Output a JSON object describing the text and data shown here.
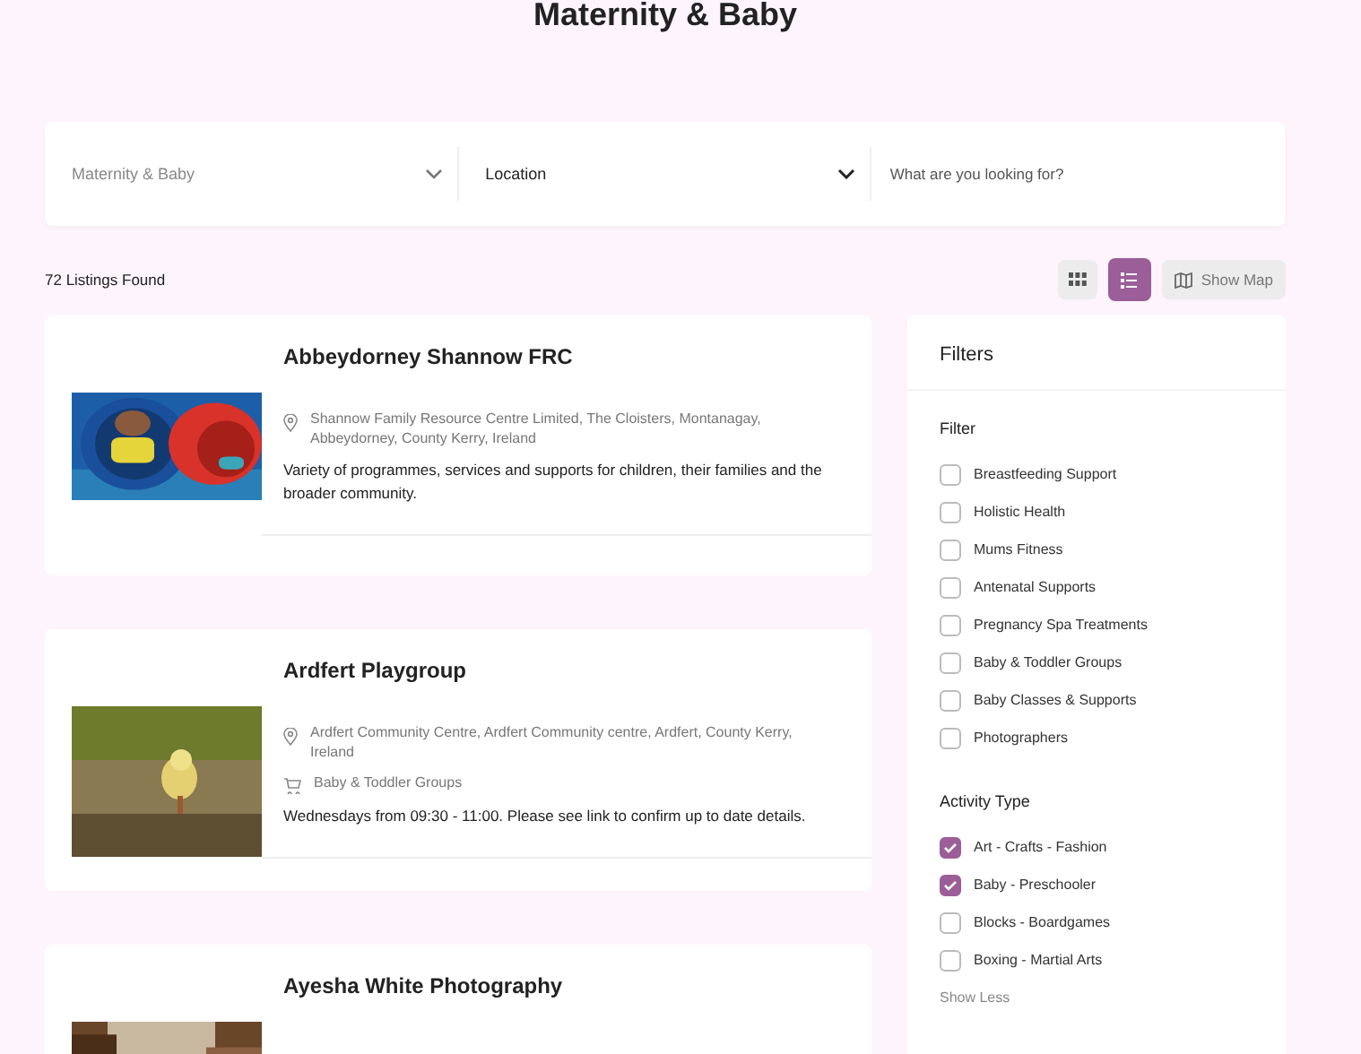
{
  "page_title": "Maternity & Baby",
  "search": {
    "category": "Maternity & Baby",
    "location": "Location",
    "placeholder": "What are you looking for?"
  },
  "results_count": "72 Listings Found",
  "view_toggles": [
    {
      "kind": "grid",
      "selected": false
    },
    {
      "kind": "list",
      "selected": true
    }
  ],
  "map_button": "Show Map",
  "listings": [
    {
      "title": "Abbeydorney Shannow FRC",
      "address": "Shannow Family Resource Centre Limited, The Cloisters, Montanagay, Abbeydorney, County Kerry, Ireland",
      "description": "Variety of programmes, services and supports for children, their families and the broader community."
    },
    {
      "title": "Ardfert Playgroup",
      "address": "Ardfert Community Centre, Ardfert Community centre, Ardfert, County Kerry, Ireland",
      "category": "Baby & Toddler Groups",
      "description": "Wednesdays from 09:30 - 11:00. Please see link to confirm up to date details."
    },
    {
      "title": "Ayesha White Photography"
    }
  ],
  "filters": {
    "title": "Filters",
    "groups": [
      {
        "heading": "Filter",
        "options": [
          {
            "label": "Breastfeeding Support",
            "checked": false
          },
          {
            "label": "Holistic Health",
            "checked": false
          },
          {
            "label": "Mums Fitness",
            "checked": false
          },
          {
            "label": "Antenatal Supports",
            "checked": false
          },
          {
            "label": "Pregnancy Spa Treatments",
            "checked": false
          },
          {
            "label": "Baby & Toddler Groups",
            "checked": false
          },
          {
            "label": "Baby Classes & Supports",
            "checked": false
          },
          {
            "label": "Photographers",
            "checked": false
          }
        ]
      },
      {
        "heading": "Activity Type",
        "options": [
          {
            "label": "Art - Crafts - Fashion",
            "checked": true
          },
          {
            "label": "Baby - Preschooler",
            "checked": true
          },
          {
            "label": "Blocks - Boardgames",
            "checked": false
          },
          {
            "label": "Boxing - Martial Arts",
            "checked": false
          }
        ],
        "toggle": "Show Less"
      }
    ]
  }
}
